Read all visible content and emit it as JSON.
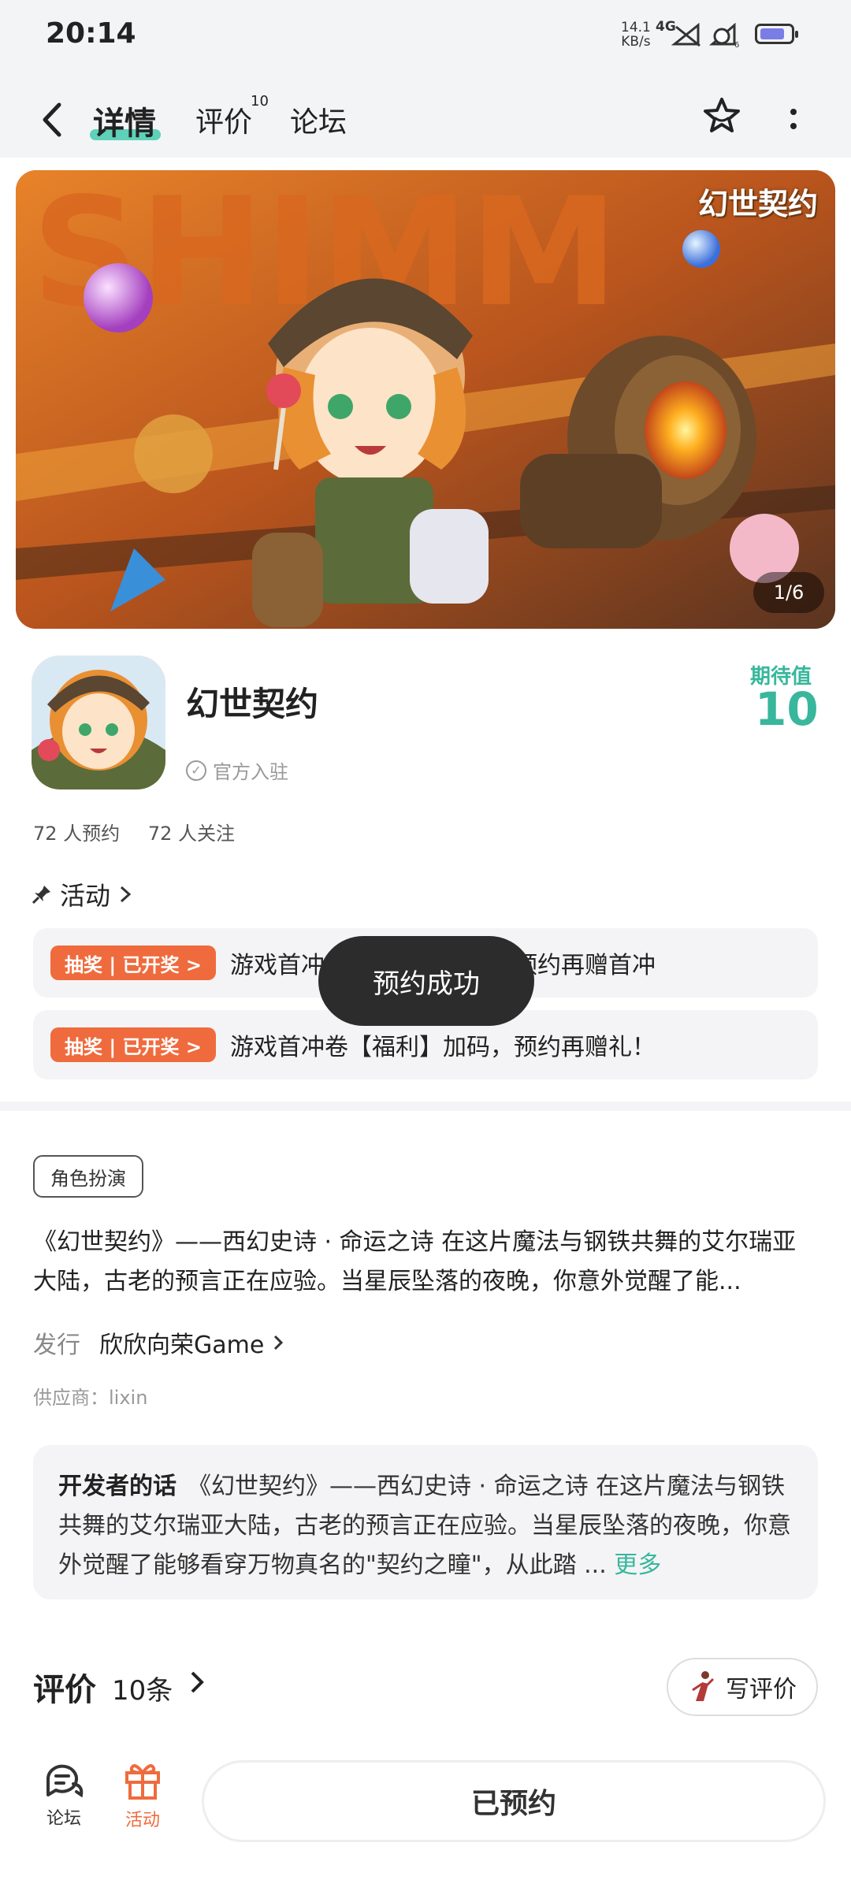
{
  "status_bar": {
    "time": "20:14",
    "net_speed_value": "14.1",
    "net_speed_unit": "KB/s",
    "network": "4G",
    "signal_sub": "6"
  },
  "header": {
    "tabs": [
      {
        "label": "详情",
        "active": true
      },
      {
        "label": "评价",
        "badge": "10"
      },
      {
        "label": "论坛"
      }
    ]
  },
  "banner": {
    "logo_text": "幻世契约",
    "counter": "1/6"
  },
  "game": {
    "title": "幻世契约",
    "official_label": "官方入驻",
    "expect_label": "期待值",
    "expect_value": "10",
    "reserve_stat": "72 人预约",
    "follow_stat": "72 人关注"
  },
  "activities": {
    "header": "活动",
    "items": [
      {
        "badge": "抽奖 | 已开奖 >",
        "text": "游戏首冲卷【福利】加码，预约再赠首冲"
      },
      {
        "badge": "抽奖 | 已开奖 >",
        "text": "游戏首冲卷【福利】加码，预约再赠礼！"
      }
    ]
  },
  "toast": "预约成功",
  "details": {
    "tag": "角色扮演",
    "description": "《幻世契约》——西幻史诗 · 命运之诗 在这片魔法与钢铁共舞的艾尔瑞亚大陆，古老的预言正在应验。当星辰坠落的夜晚，你意外觉醒了能...",
    "publisher_label": "发行",
    "publisher_name": "欣欣向荣Game",
    "supplier": "供应商：lixin",
    "developer_label": "开发者的话",
    "developer_text": "《幻世契约》——西幻史诗 · 命运之诗 在这片魔法与钢铁共舞的艾尔瑞亚大陆，古老的预言正在应验。当星辰坠落的夜晚，你意外觉醒了能够看穿万物真名的\"契约之瞳\"，从此踏 ...",
    "developer_more": "更多"
  },
  "reviews": {
    "title": "评价",
    "count": "10条",
    "write_label": "写评价"
  },
  "bottom_nav": {
    "forum_label": "论坛",
    "activity_label": "活动",
    "reserve_label": "已预约"
  },
  "colors": {
    "accent": "#38b79c",
    "tab_underline": "#5ed1b8",
    "activity_badge": "#ef6b3d",
    "activity_nav": "#ef6b3d"
  }
}
